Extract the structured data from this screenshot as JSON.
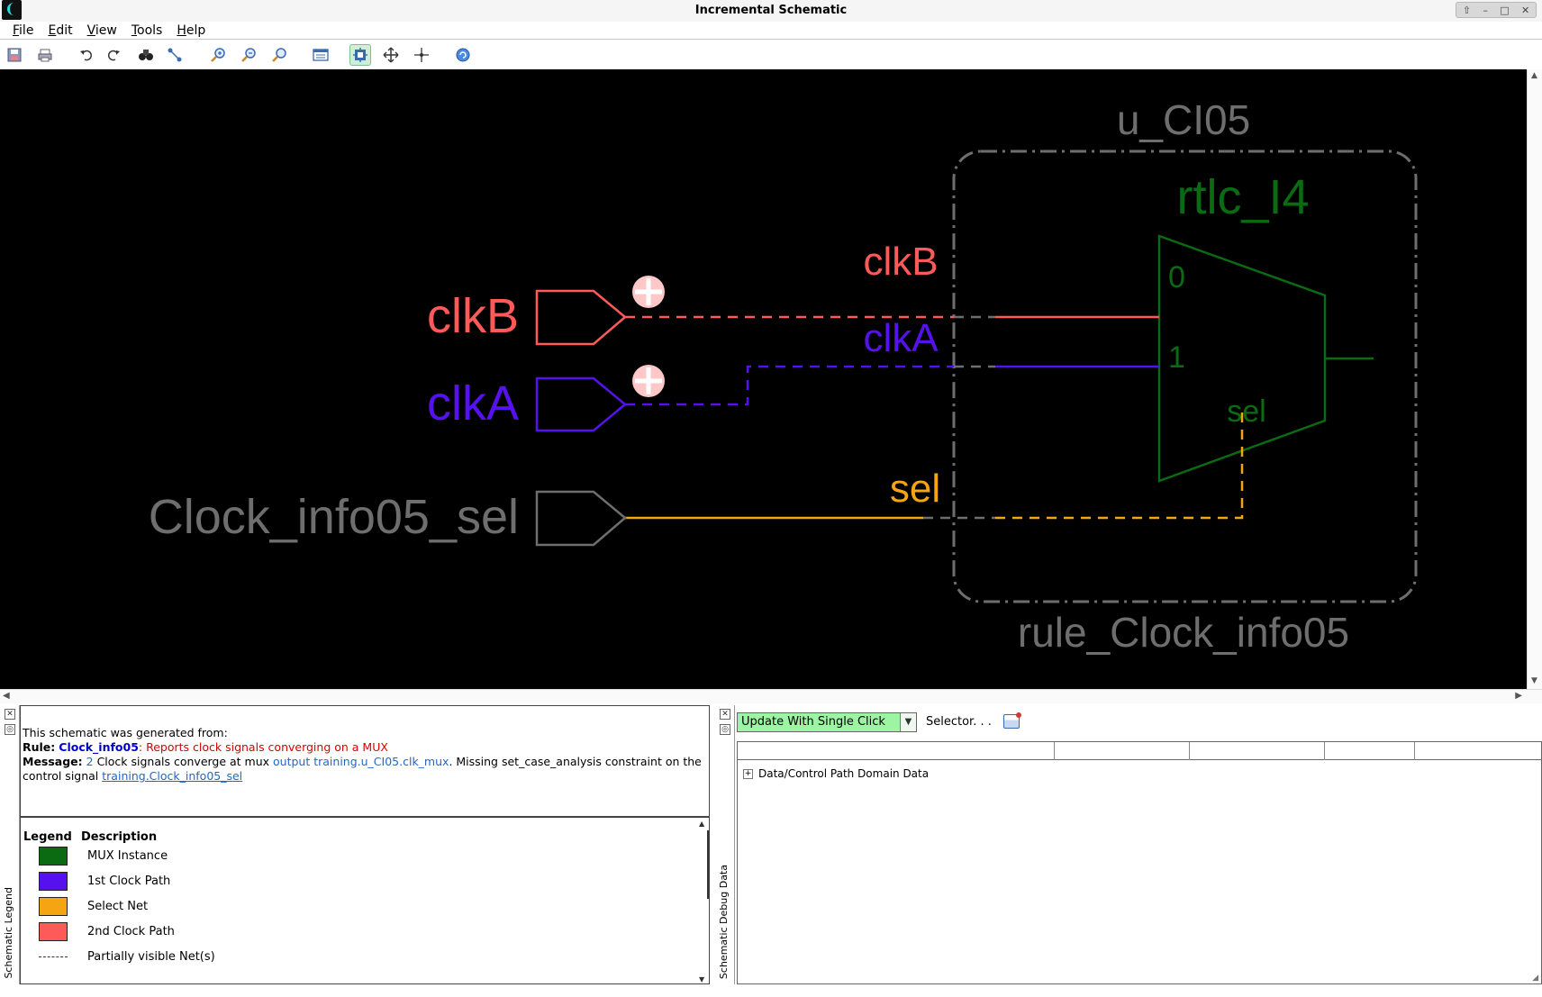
{
  "window": {
    "title": "Incremental Schematic"
  },
  "menu": [
    "File",
    "Edit",
    "View",
    "Tools",
    "Help"
  ],
  "toolbar": {
    "icons": [
      "save-icon",
      "print-icon",
      "undo-icon",
      "redo-icon",
      "find-icon",
      "fit-select-icon",
      "zoom-in-icon",
      "zoom-out-icon",
      "zoom-fit-icon",
      "window-icon",
      "auto-arrange-icon",
      "pan-icon",
      "spread-icon",
      "refresh-icon"
    ]
  },
  "schematic": {
    "colors": {
      "mux": "#0b6b12",
      "clk1": "#5511ee",
      "sel": "#f5a512",
      "clk2": "#ff5a5a",
      "grey": "#6e6e6e"
    },
    "ports": {
      "clkB": "clkB",
      "clkA": "clkA",
      "sel_port": "Clock_info05_sel"
    },
    "nets": {
      "clkB": "clkB",
      "clkA": "clkA",
      "sel": "sel"
    },
    "instance": {
      "name": "u_CI05",
      "rule": "rule_Clock_info05"
    },
    "mux": {
      "name": "rtlc_I4",
      "pin0": "0",
      "pin1": "1",
      "pin_sel": "sel"
    }
  },
  "legend_panel": {
    "side_label": "Schematic Legend",
    "info": {
      "line1": "This schematic was generated from:",
      "rule_label": "Rule:",
      "rule_name": "Clock_info05",
      "rule_desc": ": Reports clock signals converging on a MUX",
      "message_label": "Message:",
      "message_count": "2",
      "message_text1": " Clock signals converge at mux ",
      "message_link1": "output training.u_CI05.clk_mux",
      "message_text2": ". Missing set_case_analysis constraint on the control signal ",
      "message_link2": "training.Clock_info05_sel"
    },
    "legend": {
      "header_legend": "Legend",
      "header_desc": "Description",
      "rows": [
        {
          "color": "#0b6b12",
          "desc": "MUX Instance"
        },
        {
          "color": "#5511ee",
          "desc": "1st Clock Path"
        },
        {
          "color": "#f5a512",
          "desc": "Select Net"
        },
        {
          "color": "#ff5a5a",
          "desc": "2nd Clock Path"
        },
        {
          "color": "",
          "desc": "Partially visible Net(s)"
        }
      ]
    }
  },
  "debug_panel": {
    "side_label": "Schematic Debug Data",
    "update_mode": "Update With Single Click",
    "selector_label": "Selector. . .",
    "tree_item": "Data/Control Path Domain Data"
  }
}
